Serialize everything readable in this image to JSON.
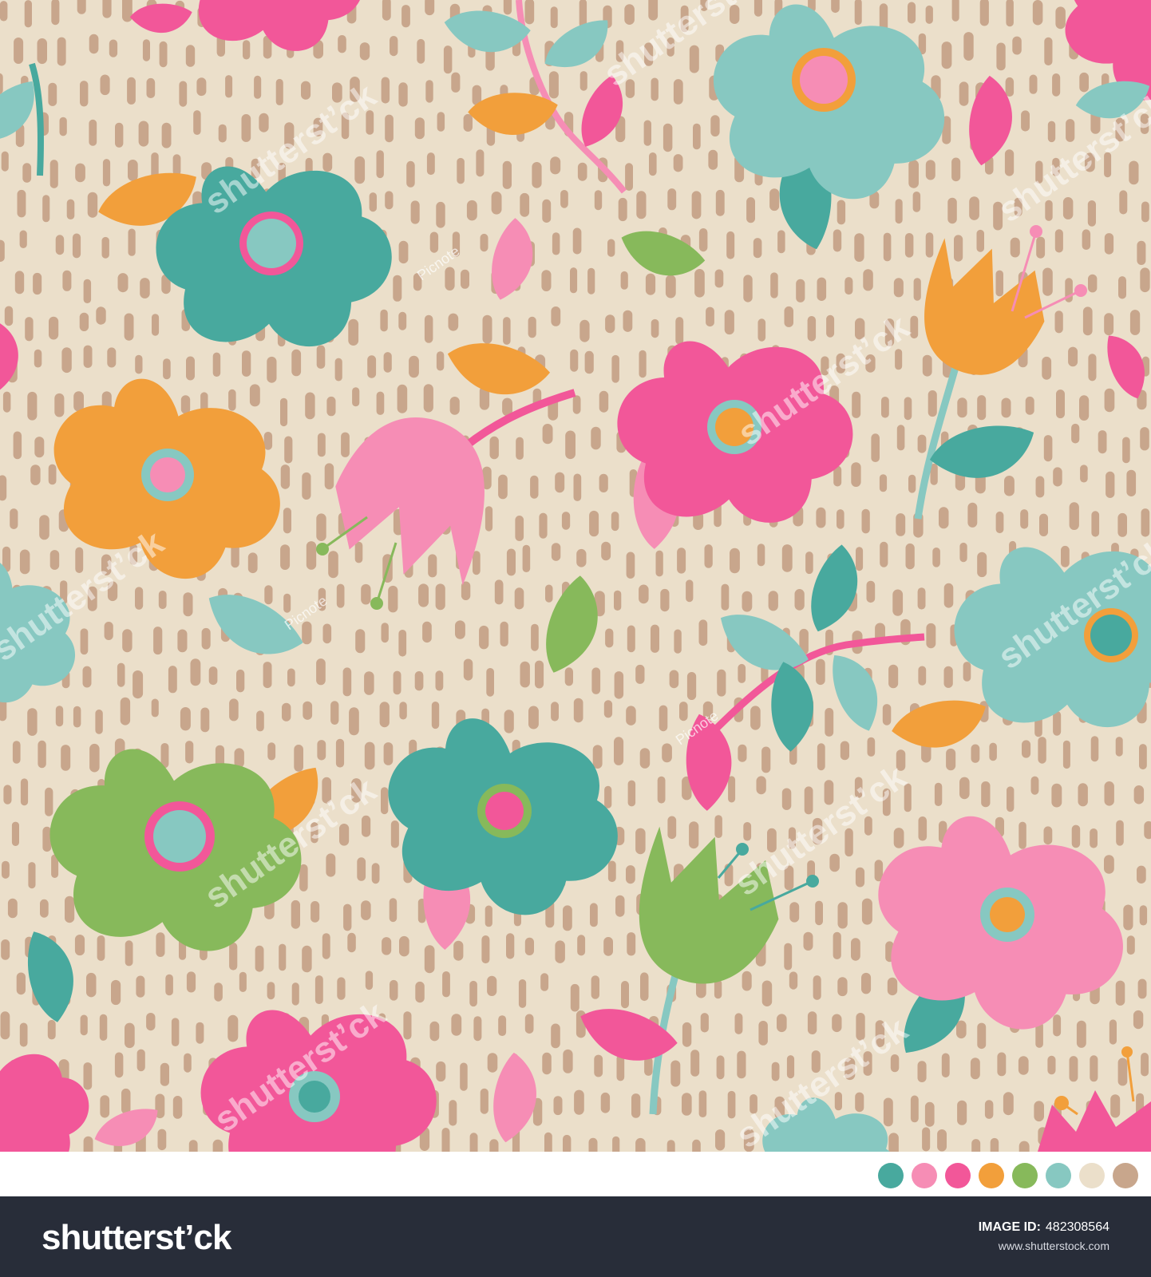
{
  "image": {
    "subject": "seamless floral pattern with speckled beige background",
    "background_color": "#ebdfca",
    "speckle_color": "#c8a68c"
  },
  "palette": [
    {
      "name": "teal",
      "hex": "#48a99e"
    },
    {
      "name": "light-pink",
      "hex": "#f68db5"
    },
    {
      "name": "hot-pink",
      "hex": "#f25799"
    },
    {
      "name": "orange",
      "hex": "#f29f3b"
    },
    {
      "name": "green",
      "hex": "#87b95b"
    },
    {
      "name": "mint",
      "hex": "#87c8c1"
    },
    {
      "name": "beige",
      "hex": "#ebdfca"
    },
    {
      "name": "tan",
      "hex": "#c8a68c"
    }
  ],
  "watermark": {
    "brand": "shutterst’ck",
    "artist": "Picnote"
  },
  "footer": {
    "logo": "shutterst’ck",
    "image_id_label": "IMAGE ID:",
    "image_id": "482308564",
    "site": "www.shutterstock.com"
  }
}
